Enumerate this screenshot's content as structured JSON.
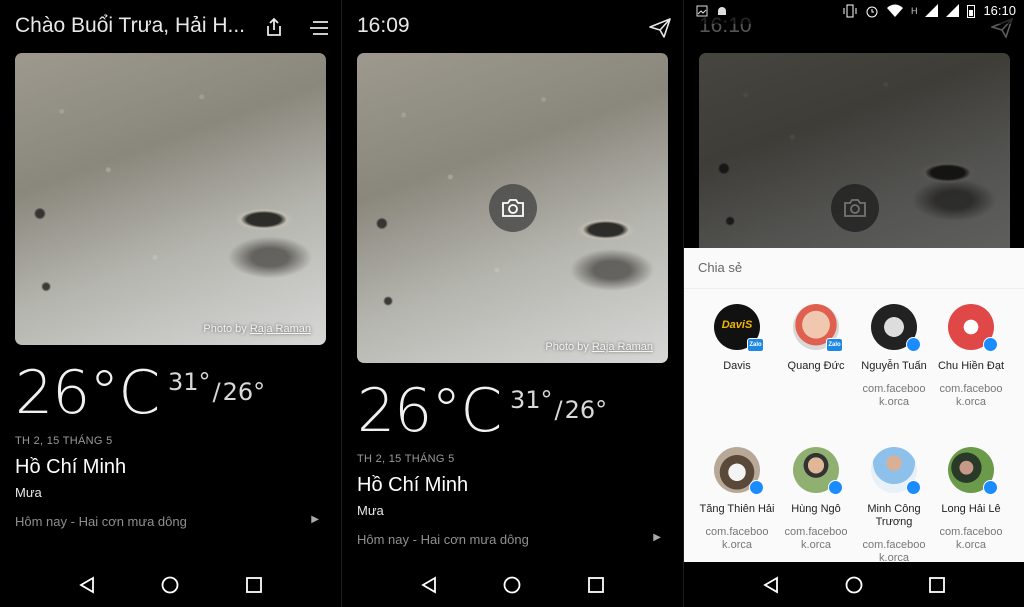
{
  "panel1": {
    "greeting": "Chào Buổi Trưa, Hải H...",
    "photo_credit_prefix": "Photo by",
    "photo_author": "Raja Raman",
    "temperature": "26°C",
    "high": "31°",
    "low": "26°",
    "date": "TH 2, 15 THÁNG 5",
    "city": "Hồ Chí Minh",
    "condition": "Mưa",
    "forecast": "Hôm nay - Hai cơn mưa dông"
  },
  "panel2": {
    "time": "16:09",
    "photo_credit_prefix": "Photo by",
    "photo_author": "Raja Raman",
    "temperature": "26°C",
    "high": "31°",
    "low": "26°",
    "date": "TH 2, 15 THÁNG 5",
    "city": "Hồ Chí Minh",
    "condition": "Mưa",
    "forecast": "Hôm nay - Hai cơn mưa dông"
  },
  "panel3": {
    "status_time": "16:10",
    "network_letter": "H",
    "background_time": "16:10",
    "share_title": "Chia sẻ",
    "share_items": [
      {
        "name": "Davis",
        "sub": "",
        "badge": "Zalo",
        "logo_text": "DaviS",
        "color": "#111111"
      },
      {
        "name": "Quang Đức",
        "sub": "",
        "badge": "Zalo",
        "logo_text": "",
        "color": "#e8b4a0"
      },
      {
        "name": "Nguyễn Tuấn",
        "sub": "com.faceboo k.orca",
        "badge": "",
        "logo_text": "",
        "color": "#222222"
      },
      {
        "name": "Chu Hiền Đạt",
        "sub": "com.faceboo k.orca",
        "badge": "",
        "logo_text": "",
        "color": "#e04848"
      },
      {
        "name": "Tăng Thiên Hải",
        "sub": "com.faceboo k.orca",
        "badge": "",
        "logo_text": "",
        "color": "#8a7a6a"
      },
      {
        "name": "Hùng Ngô",
        "sub": "com.faceboo k.orca",
        "badge": "",
        "logo_text": "",
        "color": "#5e8a4a"
      },
      {
        "name": "Minh Công Trương",
        "sub": "com.faceboo k.orca",
        "badge": "",
        "logo_text": "",
        "color": "#7aa8d8"
      },
      {
        "name": "Long Hải Lê",
        "sub": "com.faceboo k.orca",
        "badge": "",
        "logo_text": "",
        "color": "#4d7a3a"
      }
    ]
  },
  "colors": {
    "background": "#000000",
    "sheet": "#fafafa",
    "messenger_blue": "#1a8cff",
    "zalo_blue": "#1e88e5"
  }
}
